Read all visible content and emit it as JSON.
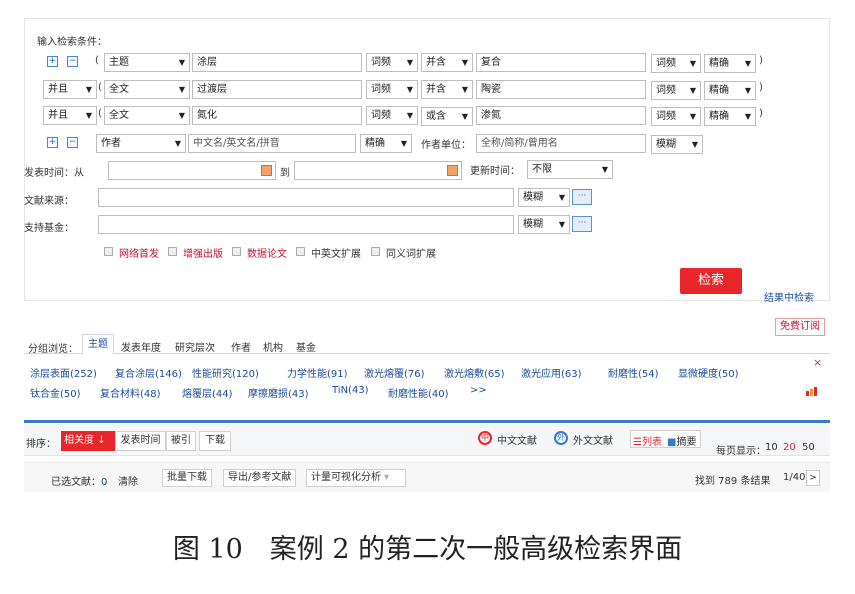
{
  "search": {
    "title": "输入检索条件：",
    "rows": [
      {
        "prefix": "",
        "field": "主题",
        "value1": "涂层",
        "freq1": "词频",
        "op": "并含",
        "value2": "复合",
        "freq2": "词频",
        "match": "精确"
      },
      {
        "prefix": "并且",
        "field": "全文",
        "value1": "过渡层",
        "freq1": "词频",
        "op": "并含",
        "value2": "陶瓷",
        "freq2": "词频",
        "match": "精确"
      },
      {
        "prefix": "并且",
        "field": "全文",
        "value1": "氮化",
        "freq1": "词频",
        "op": "或含",
        "value2": "渗氮",
        "freq2": "词频",
        "match": "精确"
      }
    ],
    "author_row": {
      "field": "作者",
      "placeholder": "中文名/英文名/拼音",
      "match": "精确",
      "unit_label": "作者单位：",
      "unit_placeholder": "全称/简称/曾用名",
      "unit_match": "模糊"
    },
    "time": {
      "label": "发表时间：从",
      "to": "到",
      "update_label": "更新时间：",
      "update_value": "不限"
    },
    "source": {
      "label": "文献来源：",
      "match": "模糊"
    },
    "fund": {
      "label": "支持基金：",
      "match": "模糊"
    },
    "checks": [
      "网络首发",
      "增强出版",
      "数据论文",
      "中英文扩展",
      "同义词扩展"
    ],
    "submit": "检索",
    "in_results": "结果中检索",
    "paren_open": "(",
    "paren_close": ")",
    "dots": "···",
    "plus": "+",
    "minus": "−",
    "arrow": "▼"
  },
  "subscribe": "免费订阅",
  "group": {
    "label": "分组浏览：",
    "tabs": [
      "主题",
      "发表年度",
      "研究层次",
      "作者",
      "机构",
      "基金"
    ],
    "keywords_row1": [
      "涂层表面(252)",
      "复合涂层(146)",
      "性能研究(120)",
      "力学性能(91)",
      "激光熔覆(76)",
      "激光熔敷(65)",
      "激光应用(63)",
      "耐磨性(54)",
      "显微硬度(50)"
    ],
    "keywords_row2": [
      "钛合金(50)",
      "复合材料(48)",
      "熔覆层(44)",
      "摩擦磨损(43)",
      "TiN(43)",
      "耐磨性能(40)",
      ">>"
    ],
    "close": "×"
  },
  "sort": {
    "label": "排序：",
    "options": [
      "相关度",
      "发表时间",
      "被引",
      "下载"
    ],
    "active_arrow": "↓",
    "lang_cn": "中文文献",
    "lang_en": "外文文献",
    "view_list": "列表",
    "view_abstract": "摘要",
    "per_page_label": "每页显示：",
    "per_page": [
      "10",
      "20",
      "50"
    ]
  },
  "toolbar": {
    "selected_label": "已选文献：",
    "selected_count": "0",
    "clear": "清除",
    "batch": "批量下载",
    "export": "导出/参考文献",
    "analysis": "计量可视化分析",
    "found": "找到 789 条结果",
    "page": "1/40",
    "next": ">"
  },
  "caption": "图 10　案例 2 的第二次一般高级检索界面",
  "colors": {
    "accent": "#e8262a",
    "link": "#1a4c9a",
    "bar": "#3a7ac8"
  }
}
